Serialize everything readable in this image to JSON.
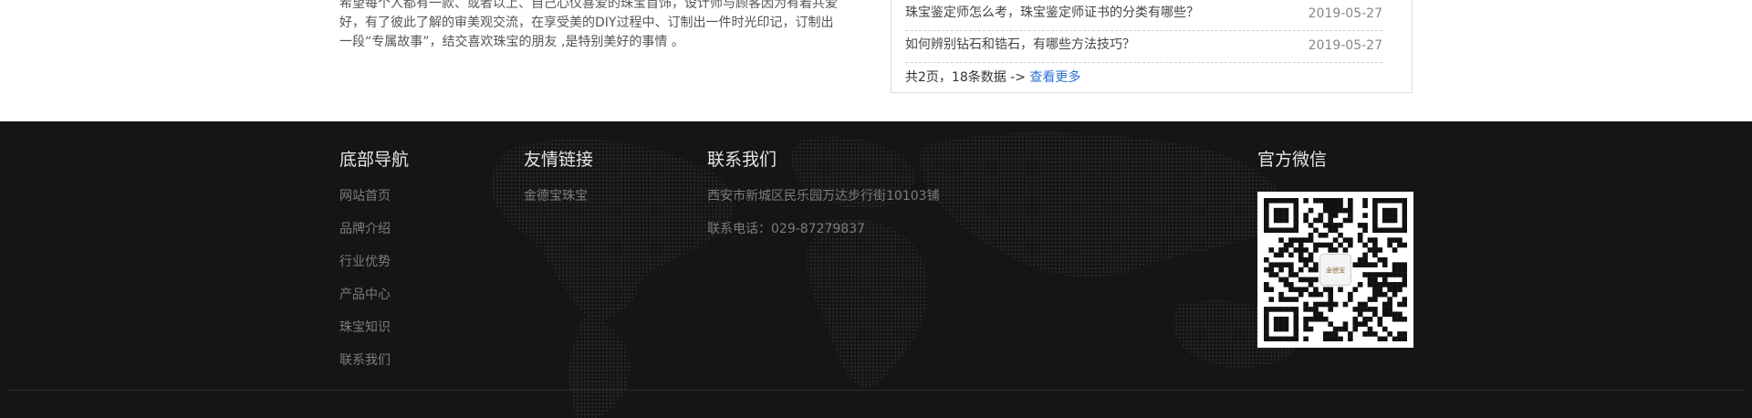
{
  "intro": {
    "line1": "希望每个人都有一款、或者以上、自己心仪喜爱的珠宝首饰，设计师与顾客因为有着共爱",
    "line2": "好，有了彼此了解的审美观交流，在享受美的DIY过程中、订制出一件时光印记，订制出",
    "line3": "一段“专属故事”，结交喜欢珠宝的朋友 ,是特别美好的事情 。"
  },
  "news": {
    "items": [
      {
        "title": "珠宝鉴定师怎么考，珠宝鉴定师证书的分类有哪些？",
        "date": "2019-05-27"
      },
      {
        "title": "如何辨别钻石和锆石，有哪些方法技巧？",
        "date": "2019-05-27"
      }
    ],
    "pager_text": "共2页，18条数据 -> ",
    "more_label": "查看更多"
  },
  "footer": {
    "nav": {
      "title": "底部导航",
      "items": [
        "网站首页",
        "品牌介绍",
        "行业优势",
        "产品中心",
        "珠宝知识",
        "联系我们"
      ]
    },
    "links": {
      "title": "友情链接",
      "items": [
        "金德宝珠宝"
      ]
    },
    "contact": {
      "title": "联系我们",
      "address": "西安市新城区民乐园万达步行街10103铺",
      "phone": "联系电话：029-87279837"
    },
    "wechat": {
      "title": "官方微信",
      "qr_center_text": "金德宝"
    }
  },
  "colors": {
    "footer_bg": "#151517",
    "link_blue": "#2e6fd0"
  }
}
